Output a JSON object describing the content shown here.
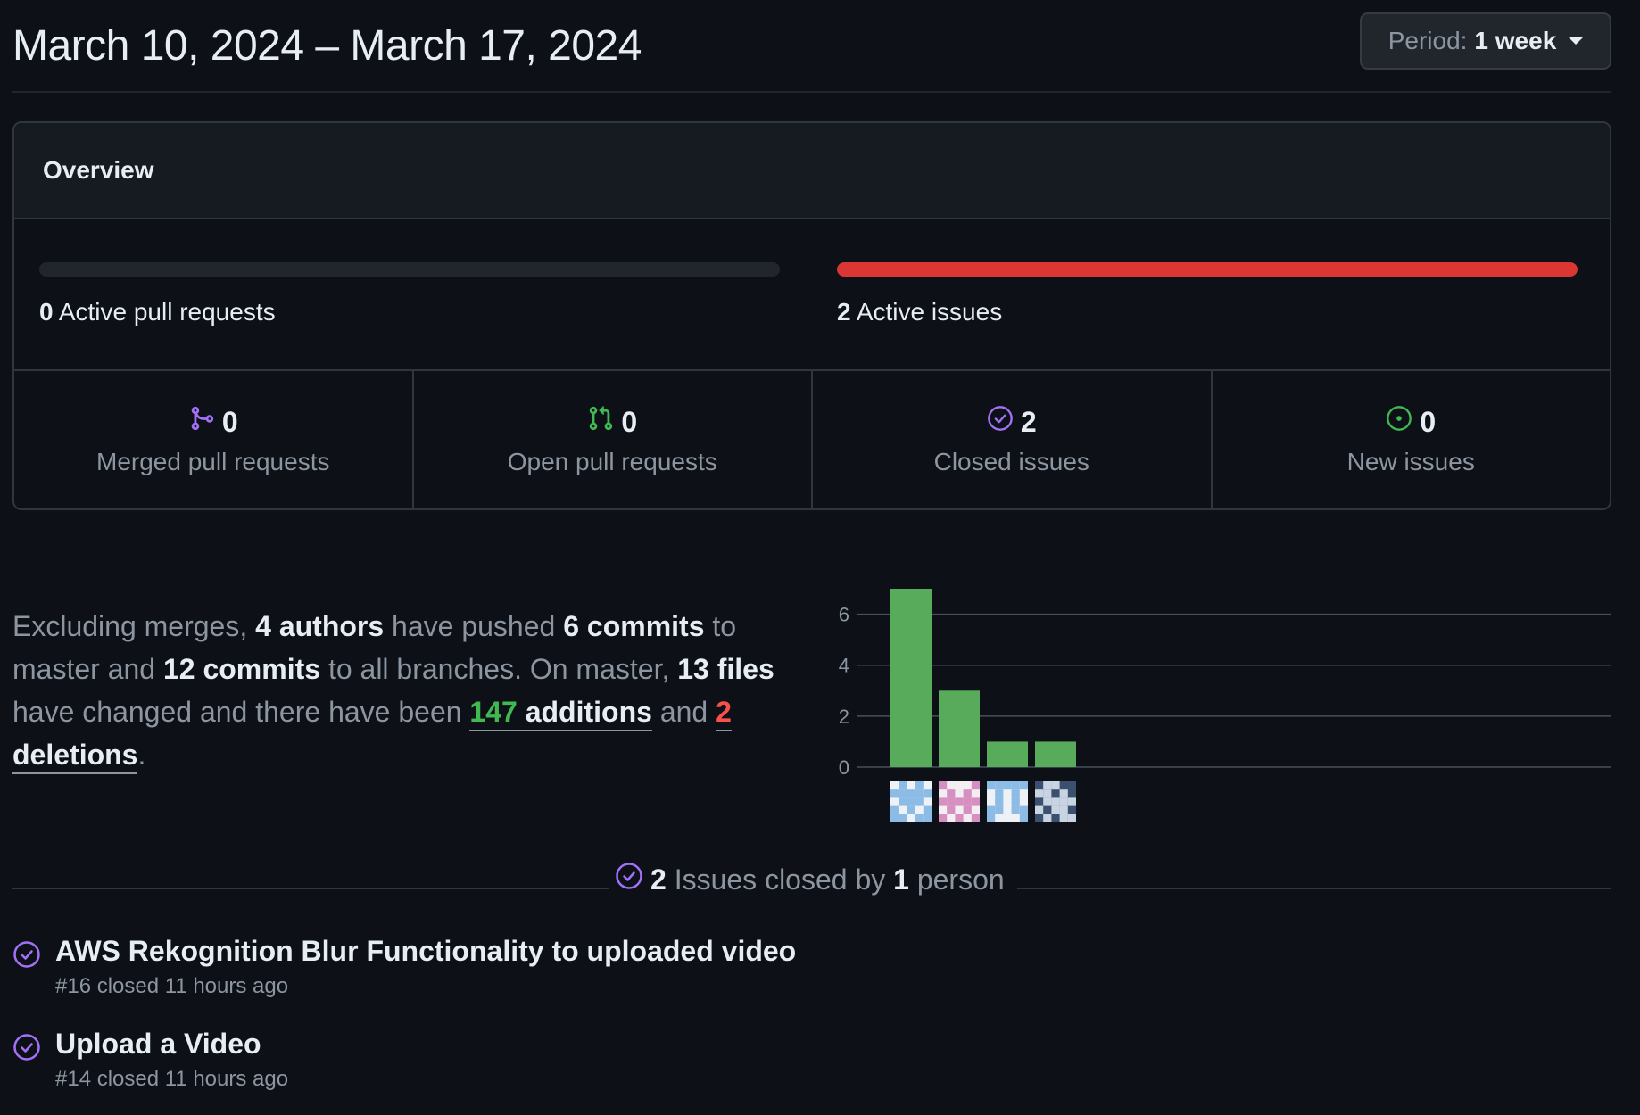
{
  "header": {
    "date_range": "March 10, 2024 – March 17, 2024",
    "period_label": "Period:",
    "period_value": "1 week"
  },
  "overview": {
    "title": "Overview",
    "active_prs": {
      "count": "0",
      "label": "Active pull requests",
      "fill_fraction": 0
    },
    "active_issues": {
      "count": "2",
      "label": "Active issues",
      "fill_fraction": 1.0
    },
    "stats": [
      {
        "icon": "merged-pr-icon",
        "value": "0",
        "label": "Merged pull requests",
        "color": "#a371f7"
      },
      {
        "icon": "open-pr-icon",
        "value": "0",
        "label": "Open pull requests",
        "color": "#3fb950"
      },
      {
        "icon": "closed-issue-icon",
        "value": "2",
        "label": "Closed issues",
        "color": "#a371f7"
      },
      {
        "icon": "new-issue-icon",
        "value": "0",
        "label": "New issues",
        "color": "#3fb950"
      }
    ]
  },
  "summary": {
    "t1": "Excluding merges, ",
    "authors": "4 authors",
    "t2": " have pushed ",
    "commits_master": "6 commits",
    "t3": " to master and ",
    "commits_all": "12 commits",
    "t4": " to all branches. On master, ",
    "files": "13 files",
    "t5": " have changed and there have been ",
    "additions_num": "147",
    "additions_word": " additions",
    "t6": " and ",
    "deletions_num": "2",
    "deletions_word": " deletions",
    "t7": "."
  },
  "chart_data": {
    "type": "bar",
    "categories": [
      "author-1",
      "author-2",
      "author-3",
      "author-4"
    ],
    "values": [
      7,
      3,
      1,
      1
    ],
    "yticks": [
      "0",
      "2",
      "4",
      "6"
    ],
    "ylim": [
      0,
      7
    ],
    "color": "#57ab5a",
    "grid": true
  },
  "issues_closed": {
    "count": "2",
    "t1": " Issues closed by ",
    "people": "1",
    "t2": " person"
  },
  "issues": [
    {
      "title": "AWS Rekognition Blur Functionality to uploaded video",
      "meta": "#16 closed 11 hours ago"
    },
    {
      "title": "Upload a Video",
      "meta": "#14 closed 11 hours ago"
    }
  ]
}
